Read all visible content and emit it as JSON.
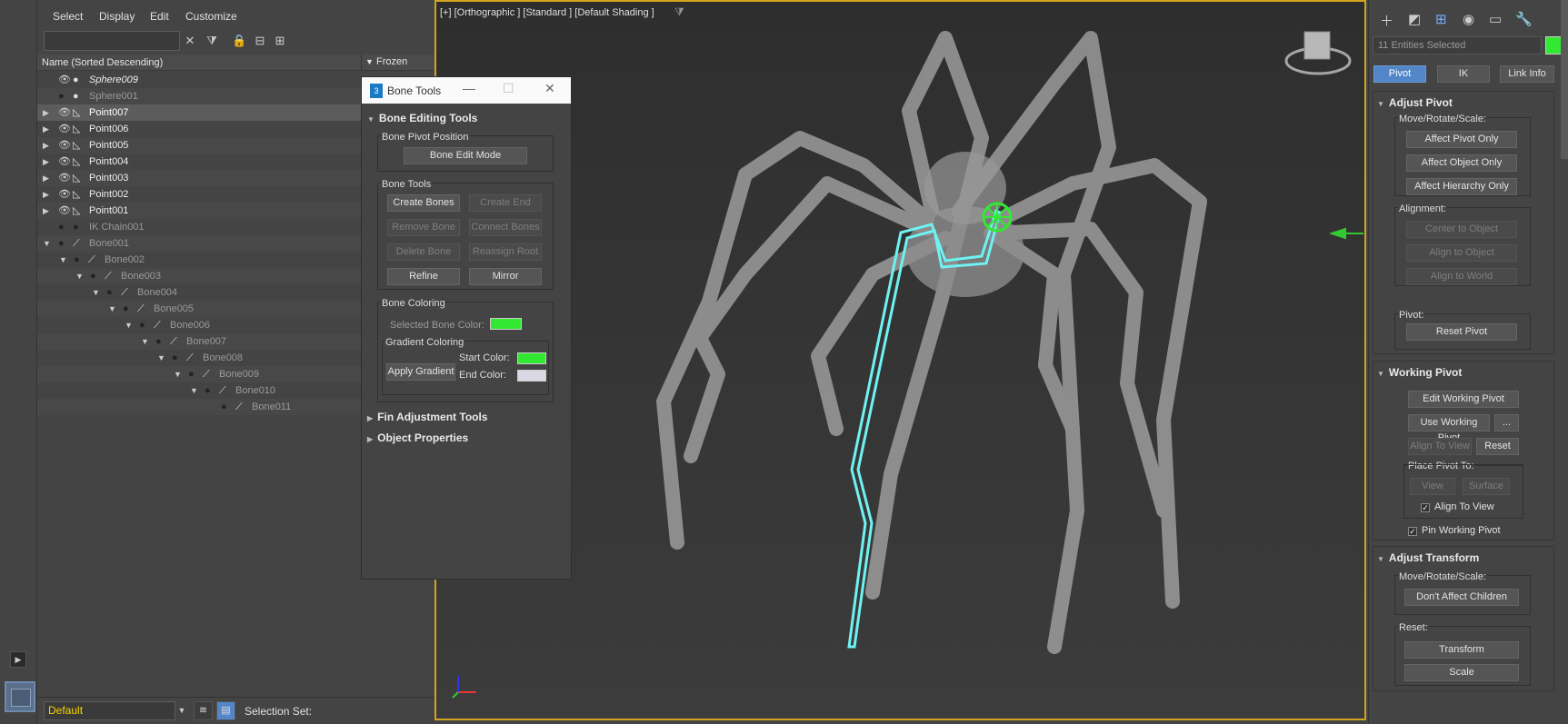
{
  "menu": [
    "Select",
    "Display",
    "Edit",
    "Customize"
  ],
  "explorer": {
    "search_placeholder": "",
    "col_name": "Name (Sorted Descending)",
    "col_frozen": "Frozen",
    "rows": [
      {
        "label": "Sphere009"
      },
      {
        "label": "Sphere001"
      },
      {
        "label": "Point007"
      },
      {
        "label": "Point006"
      },
      {
        "label": "Point005"
      },
      {
        "label": "Point004"
      },
      {
        "label": "Point003"
      },
      {
        "label": "Point002"
      },
      {
        "label": "Point001"
      },
      {
        "label": "IK Chain001"
      },
      {
        "label": "Bone001"
      },
      {
        "label": "Bone002"
      },
      {
        "label": "Bone003"
      },
      {
        "label": "Bone004"
      },
      {
        "label": "Bone005"
      },
      {
        "label": "Bone006"
      },
      {
        "label": "Bone007"
      },
      {
        "label": "Bone008"
      },
      {
        "label": "Bone009"
      },
      {
        "label": "Bone010"
      },
      {
        "label": "Bone011"
      }
    ],
    "layer": "Default",
    "selection_set_label": "Selection Set:"
  },
  "viewport": {
    "label": "[+] [Orthographic ] [Standard ] [Default Shading ]"
  },
  "bone_tools": {
    "title": "Bone Tools",
    "editing_head": "Bone Editing Tools",
    "pivot_group": "Bone Pivot Position",
    "edit_mode": "Bone Edit Mode",
    "tools_group": "Bone Tools",
    "create_bones": "Create Bones",
    "create_end": "Create End",
    "remove_bone": "Remove Bone",
    "connect_bones": "Connect Bones",
    "delete_bone": "Delete Bone",
    "reassign_root": "Reassign Root",
    "refine": "Refine",
    "mirror": "Mirror",
    "coloring_group": "Bone Coloring",
    "selected_bone_color": "Selected Bone Color:",
    "gradient_group": "Gradient Coloring",
    "apply_gradient": "Apply Gradient",
    "start_color": "Start Color:",
    "end_color": "End Color:",
    "fin_head": "Fin Adjustment Tools",
    "object_head": "Object Properties",
    "colors": {
      "selected": "#33e833",
      "start": "#33e833",
      "end": "#d9d9e6"
    }
  },
  "command_panel": {
    "selected_count": "11 Entities Selected",
    "tab_pivot": "Pivot",
    "tab_ik": "IK",
    "tab_link": "Link Info",
    "adjust_pivot_head": "Adjust Pivot",
    "mrs_label": "Move/Rotate/Scale:",
    "affect_pivot_only": "Affect Pivot Only",
    "affect_object_only": "Affect Object Only",
    "affect_hierarchy_only": "Affect Hierarchy Only",
    "alignment_label": "Alignment:",
    "center_to_object": "Center to Object",
    "align_to_object": "Align to Object",
    "align_to_world": "Align to World",
    "pivot_label": "Pivot:",
    "reset_pivot": "Reset Pivot",
    "working_pivot_head": "Working Pivot",
    "edit_working_pivot": "Edit Working Pivot",
    "use_working_pivot": "Use Working Pivot",
    "ellipsis": "...",
    "align_to_view": "Align To View",
    "reset": "Reset",
    "place_pivot_label": "Place Pivot To:",
    "view": "View",
    "surface": "Surface",
    "align_to_view_check": "Align To View",
    "pin_working_pivot": "Pin Working Pivot",
    "adjust_transform_head": "Adjust Transform",
    "mrs_label2": "Move/Rotate/Scale:",
    "dont_affect_children": "Don't Affect Children",
    "reset_label": "Reset:",
    "transform": "Transform",
    "scale": "Scale"
  }
}
